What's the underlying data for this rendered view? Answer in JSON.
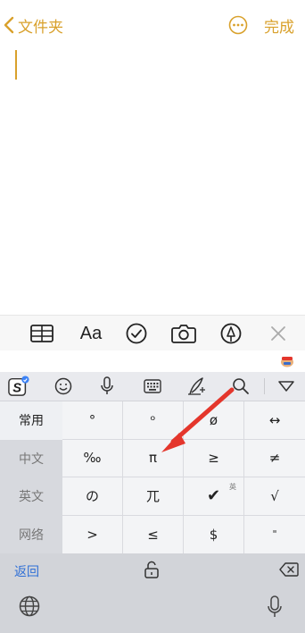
{
  "header": {
    "back_label": "文件夹",
    "more_icon": "ellipsis-circle-icon",
    "done_label": "完成"
  },
  "format_bar": {
    "items": [
      {
        "icon": "table-icon"
      },
      {
        "label": "Aa",
        "icon": "text-format-icon"
      },
      {
        "icon": "checklist-icon"
      },
      {
        "icon": "camera-icon"
      },
      {
        "icon": "markup-pen-icon"
      },
      {
        "icon": "close-icon"
      }
    ]
  },
  "keyboard": {
    "toolbar_icons": [
      "sogou-logo-icon",
      "emoji-icon",
      "microphone-icon",
      "keyboard-icon",
      "handwriting-icon",
      "search-icon",
      "collapse-icon"
    ],
    "categories": [
      {
        "label": "常用",
        "active": true
      },
      {
        "label": "中文",
        "active": false
      },
      {
        "label": "英文",
        "active": false
      },
      {
        "label": "网络",
        "active": false
      }
    ],
    "symbols": [
      [
        "°",
        "ᵒ",
        "ø",
        "↔"
      ],
      [
        "‰",
        "π",
        "≥",
        "≠"
      ],
      [
        "の",
        "兀",
        "✔",
        "√"
      ],
      [
        ">",
        "≤",
        "$",
        "\""
      ]
    ],
    "superscripts": {
      "row3_col2": "英"
    },
    "bottom": {
      "back_label": "返回"
    }
  },
  "colors": {
    "accent": "#d9a12c",
    "link_blue": "#2f6fd6",
    "arrow_red": "#e4362c"
  }
}
